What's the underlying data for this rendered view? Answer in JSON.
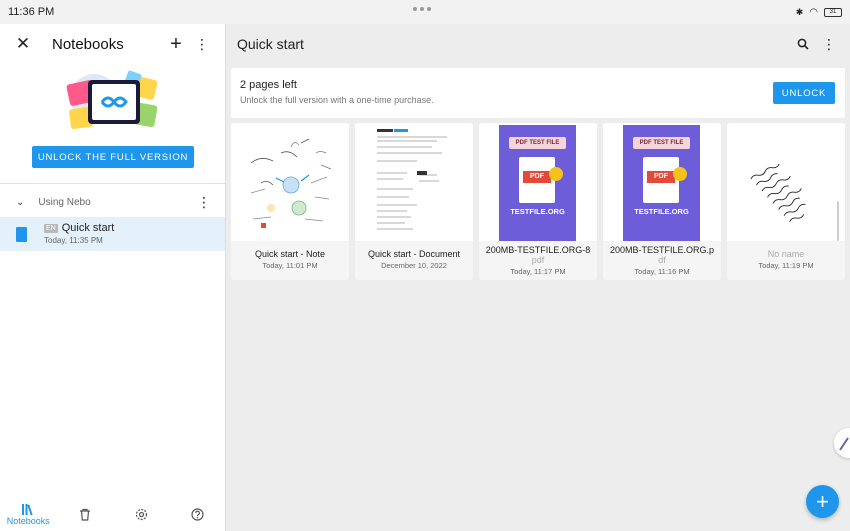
{
  "status_bar": {
    "time": "11:36 PM",
    "battery": "31"
  },
  "sidebar": {
    "title": "Notebooks",
    "unlock_label": "UNLOCK THE FULL VERSION",
    "section_label": "Using Nebo",
    "notebook": {
      "lang": "EN",
      "name": "Quick start",
      "date": "Today, 11:35 PM"
    }
  },
  "bottom_nav": {
    "notebooks_label": "Notebooks"
  },
  "main": {
    "title": "Quick start",
    "banner": {
      "title": "2 pages left",
      "subtitle": "Unlock the full version with a one-time purchase.",
      "button": "UNLOCK"
    },
    "pages": [
      {
        "name": "Quick start - Note",
        "date": "Today, 11:01 PM"
      },
      {
        "name": "Quick start - Document",
        "date": "December 10, 2022"
      },
      {
        "name": "200MB-TESTFILE.ORG-8",
        "ext": "pdf",
        "date": "Today, 11:17 PM",
        "pdf_title": "PDF TEST FILE",
        "pdf_site": "TESTFILE.ORG",
        "pdf_badge": "PDF"
      },
      {
        "name": "200MB-TESTFILE.ORG.p",
        "ext": "df",
        "date": "Today, 11:16 PM",
        "pdf_title": "PDF TEST FILE",
        "pdf_site": "TESTFILE.ORG",
        "pdf_badge": "PDF"
      },
      {
        "name": "No name",
        "date": "Today, 11:19 PM"
      }
    ]
  },
  "colors": {
    "accent": "#1e96ec",
    "selected_bg": "#e4f1fb"
  }
}
